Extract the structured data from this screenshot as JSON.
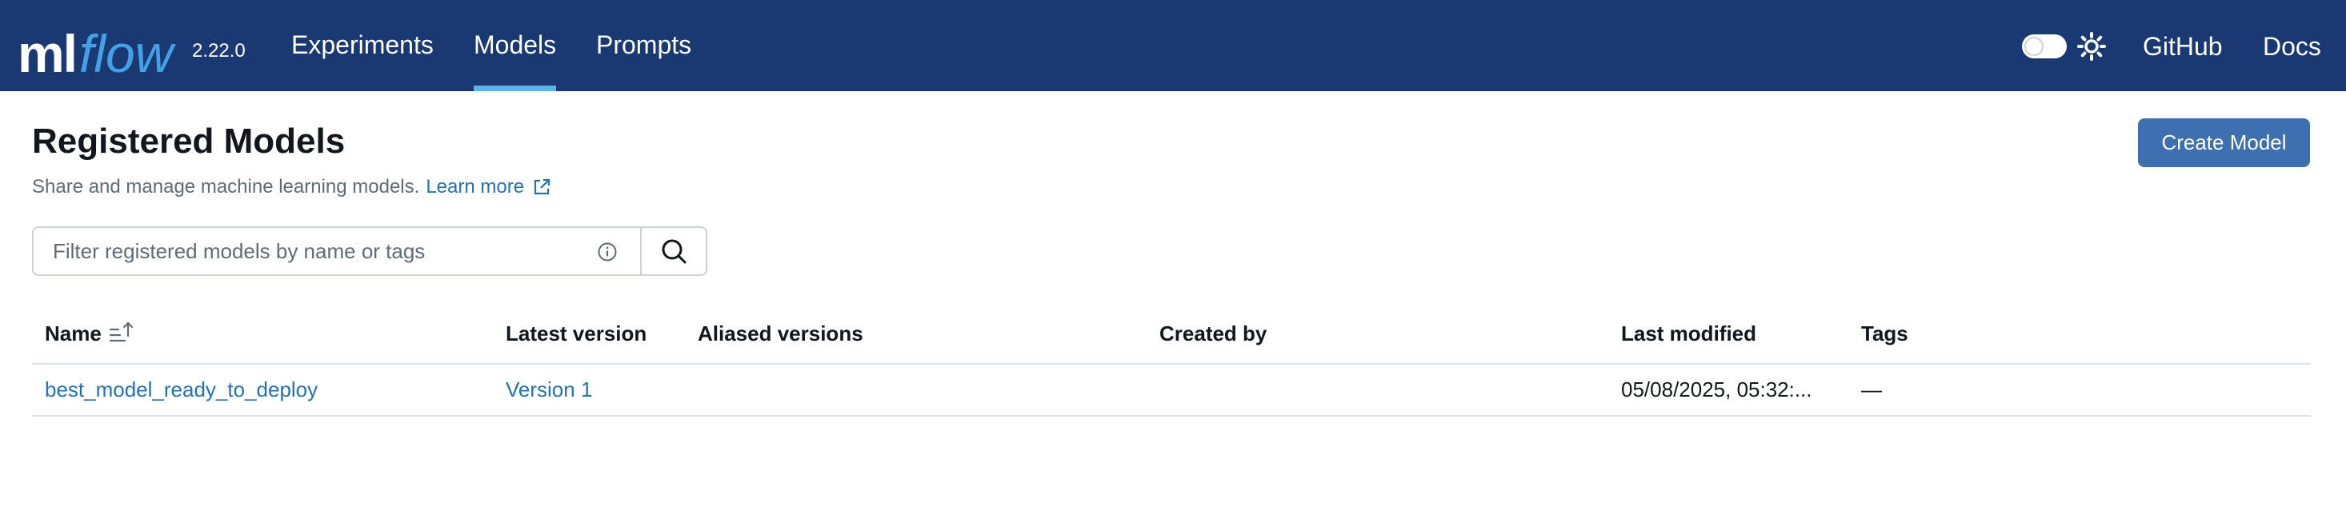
{
  "app": {
    "logo_ml": "ml",
    "logo_flow": "flow",
    "version": "2.22.0",
    "brand_color": "#1a3872",
    "accent_color": "#43a1e8"
  },
  "nav": {
    "items": [
      {
        "label": "Experiments",
        "active": false
      },
      {
        "label": "Models",
        "active": true
      },
      {
        "label": "Prompts",
        "active": false
      }
    ],
    "theme_icon": "sun-icon",
    "github_label": "GitHub",
    "docs_label": "Docs"
  },
  "page": {
    "title": "Registered Models",
    "description": "Share and manage machine learning models.",
    "learn_more_label": "Learn more",
    "learn_more_icon": "external-link-icon",
    "create_button_label": "Create Model"
  },
  "search": {
    "placeholder": "Filter registered models by name or tags",
    "value": "",
    "info_icon": "info-icon",
    "button_icon": "search-icon"
  },
  "table": {
    "columns": [
      "Name",
      "Latest version",
      "Aliased versions",
      "Created by",
      "Last modified",
      "Tags"
    ],
    "sort_icon": "sort-ascending-icon",
    "rows": [
      {
        "name": "best_model_ready_to_deploy",
        "latest_version": "Version 1",
        "aliased_versions": "",
        "created_by": "",
        "last_modified": "05/08/2025, 05:32:...",
        "tags": "—"
      }
    ]
  }
}
